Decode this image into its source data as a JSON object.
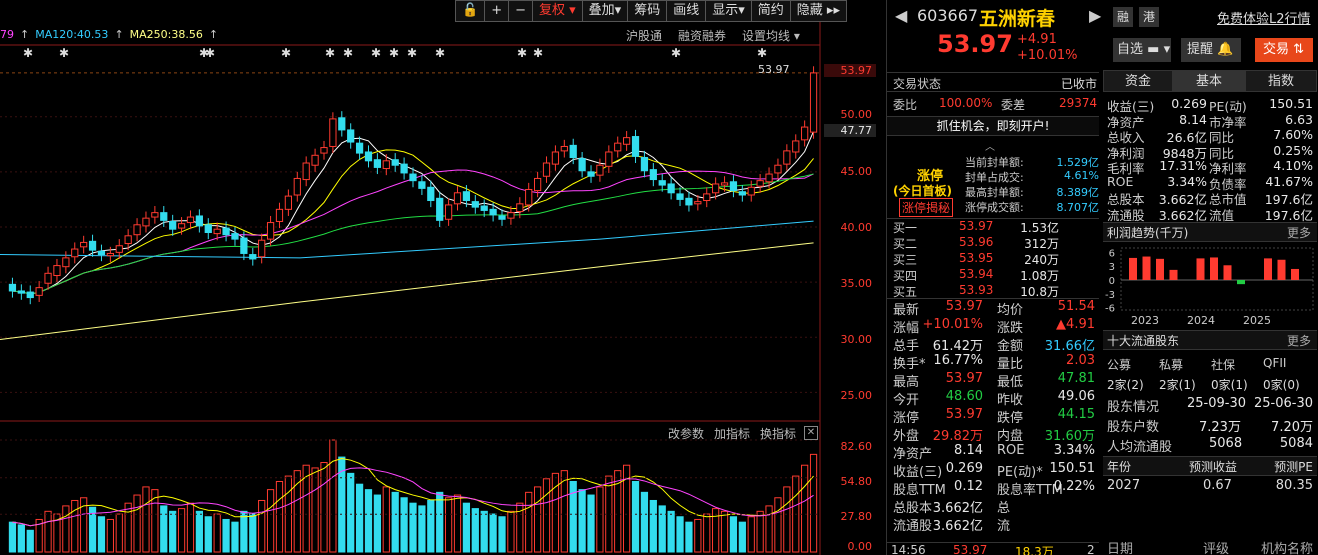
{
  "toolbar": {
    "items": [
      "复权 ▾",
      "叠加▾",
      "筹码",
      "画线",
      "显示▾",
      "简约",
      "隐藏 ▸▸"
    ]
  },
  "ma": [
    {
      "label": "79",
      "color": "#ff44ff"
    },
    {
      "label": "MA120:40.53",
      "color": "#33ccff"
    },
    {
      "label": "MA250:38.56",
      "color": "#ffff88"
    }
  ],
  "chart_links": [
    "沪股通",
    "融资融券",
    "设置均线 ▾"
  ],
  "indicator_links": [
    "改参数",
    "加指标",
    "换指标"
  ],
  "price_axis": [
    "53.97",
    "50.00",
    "47.77",
    "45.00",
    "40.00",
    "35.00",
    "30.00",
    "25.00"
  ],
  "volume_axis": [
    "82.60",
    "54.80",
    "27.80",
    "0.00"
  ],
  "chart_high_label": "53.97",
  "chart_data": {
    "type": "candlestick",
    "close": [
      34.2,
      34.0,
      33.6,
      34.5,
      35.8,
      36.5,
      37.2,
      38.0,
      38.6,
      37.9,
      37.5,
      37.6,
      38.3,
      39.2,
      40.2,
      40.8,
      41.3,
      40.6,
      39.8,
      40.3,
      40.9,
      40.1,
      39.5,
      39.8,
      39.3,
      38.9,
      37.6,
      37.1,
      38.8,
      40.4,
      41.6,
      42.8,
      44.4,
      45.8,
      46.5,
      47.2,
      49.8,
      48.8,
      47.7,
      46.7,
      46.0,
      45.4,
      46.0,
      45.6,
      44.9,
      44.2,
      43.5,
      42.4,
      40.6,
      42.0,
      43.1,
      42.4,
      41.8,
      41.5,
      41.1,
      40.7,
      41.3,
      42.1,
      43.4,
      44.4,
      45.8,
      46.8,
      47.3,
      46.3,
      45.1,
      44.6,
      45.6,
      46.8,
      47.6,
      48.1,
      46.4,
      45.1,
      44.3,
      43.8,
      43.1,
      42.5,
      42.0,
      42.3,
      43.0,
      43.9,
      44.0,
      43.3,
      42.9,
      43.6,
      44.2,
      44.8,
      45.6,
      46.9,
      47.8,
      49.06,
      53.97
    ],
    "open": [
      34.8,
      34.2,
      34.1,
      33.8,
      34.9,
      35.6,
      36.4,
      37.3,
      38.2,
      38.7,
      37.8,
      37.4,
      37.7,
      38.5,
      39.3,
      40.1,
      40.9,
      41.3,
      40.5,
      39.9,
      40.4,
      41.0,
      40.2,
      39.4,
      39.9,
      39.4,
      39.0,
      37.5,
      37.3,
      38.9,
      40.5,
      41.6,
      42.9,
      44.3,
      45.6,
      46.7,
      47.3,
      49.9,
      48.8,
      47.6,
      46.8,
      46.1,
      45.3,
      46.1,
      45.7,
      44.8,
      44.1,
      43.6,
      42.6,
      40.7,
      42.1,
      43.2,
      42.3,
      41.9,
      41.6,
      41.0,
      40.8,
      41.4,
      42.0,
      43.3,
      44.6,
      45.7,
      46.9,
      47.4,
      46.2,
      45.0,
      44.7,
      45.5,
      46.9,
      47.5,
      48.2,
      46.3,
      45.2,
      44.2,
      43.9,
      43.0,
      42.6,
      42.1,
      42.4,
      43.1,
      43.8,
      44.1,
      43.2,
      42.9,
      43.7,
      44.1,
      44.9,
      45.7,
      46.8,
      47.9,
      48.6
    ],
    "volume": [
      22,
      20,
      16,
      24,
      30,
      28,
      34,
      38,
      40,
      33,
      26,
      24,
      28,
      36,
      42,
      48,
      46,
      34,
      30,
      32,
      36,
      30,
      26,
      28,
      24,
      22,
      30,
      28,
      38,
      46,
      52,
      56,
      60,
      64,
      62,
      66,
      82.6,
      70,
      58,
      50,
      46,
      42,
      48,
      44,
      40,
      36,
      34,
      38,
      44,
      40,
      42,
      36,
      32,
      30,
      28,
      26,
      30,
      36,
      44,
      48,
      54,
      58,
      60,
      52,
      46,
      42,
      48,
      56,
      60,
      64,
      52,
      44,
      38,
      34,
      30,
      26,
      22,
      24,
      28,
      32,
      30,
      26,
      22,
      26,
      30,
      34,
      40,
      48,
      56,
      64,
      72
    ],
    "ma120_last": 40.53,
    "ma250_last": 38.56,
    "ylim": [
      22.5,
      56.5
    ]
  },
  "stock": {
    "code": "603667",
    "name": "五洲新春",
    "tag1": "融",
    "tag2": "港",
    "l2": "免费体验L2行情",
    "price": "53.97",
    "chg": "+4.91",
    "pct": "+10.01%",
    "btn_watch": "自选",
    "btn_remind": "提醒",
    "btn_trade": "交易"
  },
  "status": {
    "label": "交易状态",
    "value": "已收市",
    "weibi_label": "委比",
    "weibi": "100.00%",
    "weicha_label": "委差",
    "weicha": "29374",
    "promo": "抓住机会，即刻开户!"
  },
  "limit": {
    "title": "涨停",
    "sub": "(今日首板)",
    "btn": "涨停揭秘",
    "rows": [
      {
        "k": "当前封单额:",
        "v": "1.529亿"
      },
      {
        "k": "封单占成交:",
        "v": "4.61%"
      },
      {
        "k": "最高封单额:",
        "v": "8.389亿"
      },
      {
        "k": "涨停成交额:",
        "v": "8.707亿"
      }
    ]
  },
  "bids": [
    {
      "k": "买一",
      "p": "53.97",
      "v": "1.53亿"
    },
    {
      "k": "买二",
      "p": "53.96",
      "v": "312万"
    },
    {
      "k": "买三",
      "p": "53.95",
      "v": "240万"
    },
    {
      "k": "买四",
      "p": "53.94",
      "v": "1.08万"
    },
    {
      "k": "买五",
      "p": "53.93",
      "v": "10.8万"
    }
  ],
  "quote": [
    {
      "k1": "最新",
      "v1": "53.97",
      "c1": "red",
      "k2": "均价",
      "v2": "51.54",
      "c2": "red"
    },
    {
      "k1": "涨幅",
      "v1": "+10.01%",
      "c1": "red",
      "k2": "涨跌",
      "v2": "▲4.91",
      "c2": "red"
    },
    {
      "k1": "总手",
      "v1": "61.42万",
      "c1": "white",
      "k2": "金额",
      "v2": "31.66亿",
      "c2": "cyan"
    },
    {
      "k1": "换手*",
      "v1": "16.77%",
      "c1": "white",
      "k2": "量比",
      "v2": "2.03",
      "c2": "red"
    },
    {
      "k1": "最高",
      "v1": "53.97",
      "c1": "red",
      "k2": "最低",
      "v2": "47.81",
      "c2": "green"
    },
    {
      "k1": "今开",
      "v1": "48.60",
      "c1": "green",
      "k2": "昨收",
      "v2": "49.06",
      "c2": "white"
    },
    {
      "k1": "涨停",
      "v1": "53.97",
      "c1": "red",
      "k2": "跌停",
      "v2": "44.15",
      "c2": "green"
    },
    {
      "k1": "外盘",
      "v1": "29.82万",
      "c1": "red",
      "k2": "内盘",
      "v2": "31.60万",
      "c2": "green"
    },
    {
      "k1": "净资产",
      "v1": "8.14",
      "c1": "white",
      "k2": "ROE",
      "v2": "3.34%",
      "c2": "white"
    },
    {
      "k1": "收益(三)",
      "v1": "0.269",
      "c1": "white",
      "k2": "PE(动)*",
      "v2": "150.51",
      "c2": "white"
    },
    {
      "k1": "股息TTM",
      "v1": "0.12",
      "c1": "white",
      "k2": "股息率TTM",
      "v2": "0.22%",
      "c2": "white"
    },
    {
      "k1": "总股本",
      "v1": "3.662亿",
      "c1": "white",
      "k2": "总",
      "v2": "",
      "c2": "white"
    },
    {
      "k1": "流通股",
      "v1": "3.662亿",
      "c1": "white",
      "k2": "流",
      "v2": "",
      "c2": "white"
    }
  ],
  "tick": {
    "time": "14:56",
    "price": "53.97",
    "vol": "18.3万",
    "n": "2"
  },
  "tabs": [
    "资金",
    "基本",
    "指数"
  ],
  "fundamentals": [
    {
      "k1": "收益(三)",
      "v1": "0.269",
      "k2": "PE(动)",
      "v2": "150.51"
    },
    {
      "k1": "净资产",
      "v1": "8.14",
      "k2": "市净率",
      "v2": "6.63"
    },
    {
      "k1": "总收入",
      "v1": "26.6亿",
      "k2": "同比",
      "v2": "7.60%"
    },
    {
      "k1": "净利润",
      "v1": "9848万",
      "k2": "同比",
      "v2": "0.25%"
    },
    {
      "k1": "毛利率",
      "v1": "17.31%",
      "k2": "净利率",
      "v2": "4.10%"
    },
    {
      "k1": "ROE",
      "v1": "3.34%",
      "k2": "负债率",
      "v2": "41.67%"
    },
    {
      "k1": "总股本",
      "v1": "3.662亿",
      "k2": "总市值",
      "v2": "197.6亿"
    },
    {
      "k1": "流通股",
      "v1": "3.662亿",
      "k2": "流值",
      "v2": "197.6亿"
    }
  ],
  "profit": {
    "title": "利润趋势(千万)",
    "more": "更多",
    "yaxis": [
      "6",
      "3",
      "0",
      "-3",
      "-6"
    ],
    "years": [
      "2023",
      "2024",
      "2025"
    ],
    "bars": [
      4.8,
      5.1,
      4.6,
      2.2,
      0,
      4.7,
      4.9,
      3.2,
      -0.9,
      0,
      4.7,
      4.4,
      2.4
    ]
  },
  "holders": {
    "title": "十大流通股东",
    "more": "更多",
    "cats": [
      "公募",
      "私募",
      "社保",
      "QFII"
    ],
    "vals": [
      "2家(2)",
      "2家(1)",
      "0家(1)",
      "0家(0)"
    ],
    "rows": [
      {
        "k": "股东情况",
        "a": "25-09-30",
        "b": "25-06-30"
      },
      {
        "k": "股东户数",
        "a": "7.23万",
        "b": "7.20万"
      },
      {
        "k": "人均流通股",
        "a": "5068",
        "b": "5084"
      }
    ]
  },
  "forecast": {
    "h1": "年份",
    "h2": "预测收益",
    "h3": "预测PE",
    "rows": [
      {
        "y": "2027",
        "e": "0.67",
        "pe": "80.35"
      }
    ],
    "footer": [
      "日期",
      "评级",
      "机构名称"
    ]
  }
}
